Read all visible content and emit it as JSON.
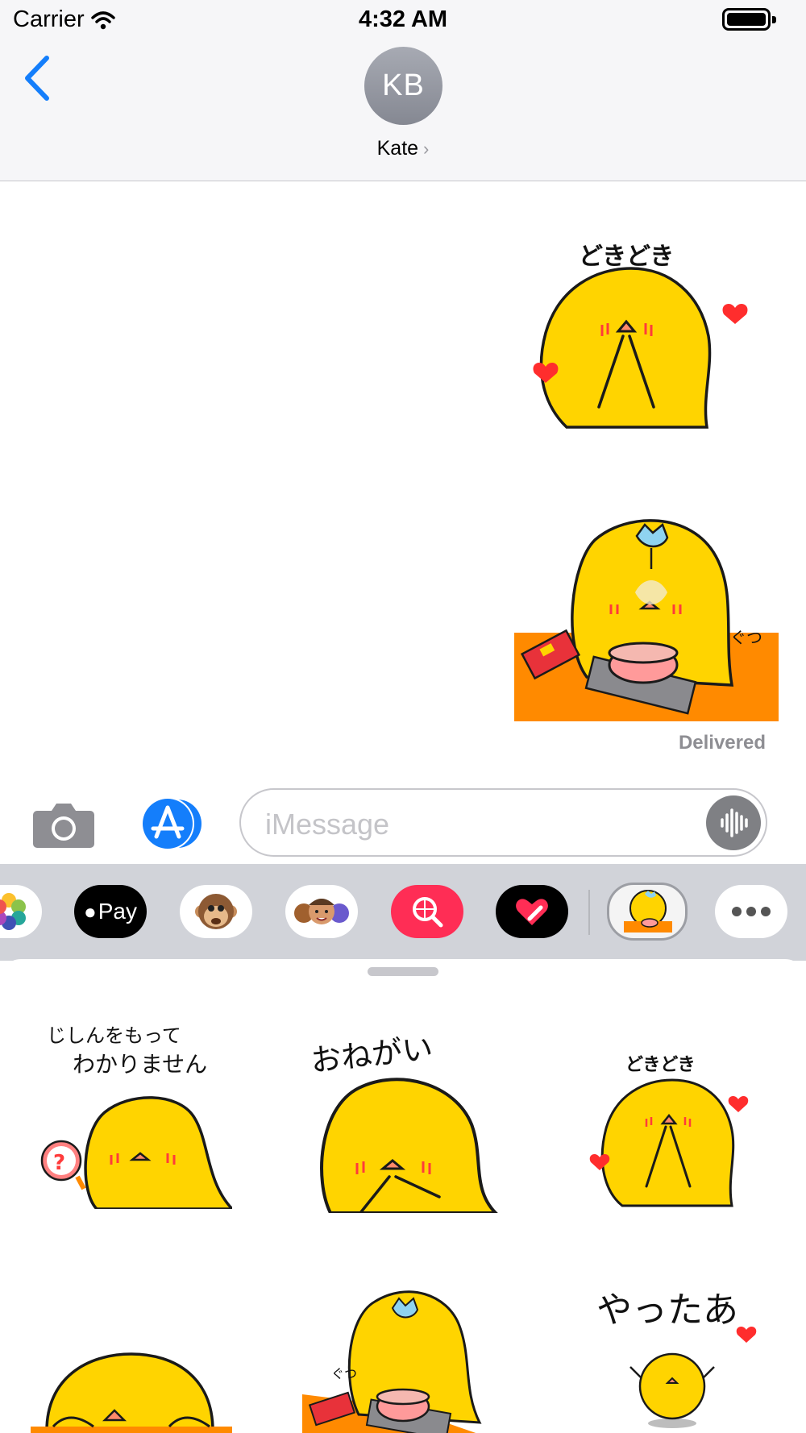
{
  "status_bar": {
    "carrier": "Carrier",
    "time": "4:32 AM"
  },
  "nav": {
    "avatar_initials": "KB",
    "contact_name": "Kate",
    "contact_chevron": "›"
  },
  "conversation": {
    "messages": [
      {
        "type": "sticker",
        "caption": "どきどき",
        "icon": "dokidoki-chick-sticker"
      },
      {
        "type": "sticker",
        "caption": "ぐつ",
        "icon": "cooking-chick-sticker"
      }
    ],
    "delivered_status": "Delivered"
  },
  "input": {
    "placeholder": "iMessage"
  },
  "app_drawer": {
    "apps": [
      {
        "name": "photos-app",
        "label": ""
      },
      {
        "name": "apple-pay-app",
        "label": "Pay"
      },
      {
        "name": "animoji-app",
        "label": ""
      },
      {
        "name": "memoji-app",
        "label": ""
      },
      {
        "name": "web-search-app",
        "label": ""
      },
      {
        "name": "digital-touch-app",
        "label": ""
      },
      {
        "name": "chick-sticker-app",
        "label": ""
      },
      {
        "name": "more-apps",
        "label": ""
      }
    ]
  },
  "sticker_panel": {
    "stickers": [
      {
        "caption_line1": "じしんをもって",
        "caption_line2": "わかりません",
        "icon": "unsure-chick-sticker"
      },
      {
        "caption_line1": "おねがい",
        "icon": "please-chick-sticker"
      },
      {
        "caption_line1": "どきどき",
        "icon": "dokidoki-chick-sticker"
      },
      {
        "caption_line1": "",
        "icon": "peeking-chick-sticker"
      },
      {
        "caption_line1": "ぐつ",
        "icon": "cooking-chick-sticker"
      },
      {
        "caption_line1": "やったあ",
        "icon": "yatta-chick-sticker"
      }
    ]
  },
  "colors": {
    "accent": "#147efb",
    "chick_yellow": "#ffd400",
    "chick_outline": "#1a1a1a",
    "heart": "#ff2d2d",
    "table_orange": "#ff8a00"
  }
}
